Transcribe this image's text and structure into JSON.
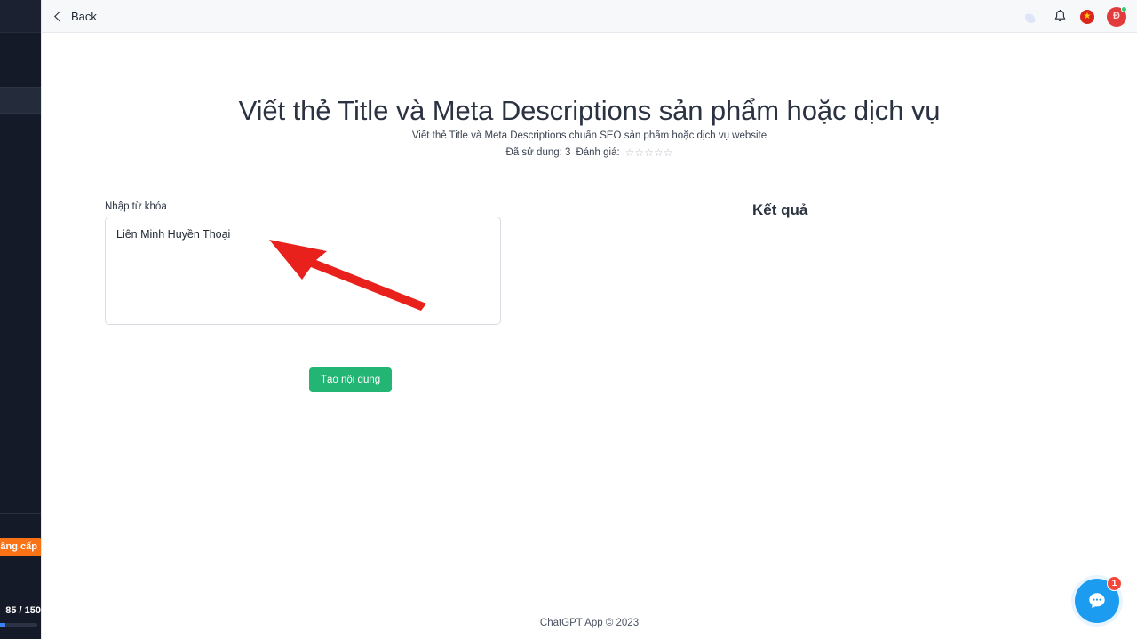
{
  "sidebar": {
    "upgrade_label": "Nâng cấp",
    "quota_label": "85 / 150",
    "quota_used": 85,
    "quota_total": 150,
    "progress_percent": 57,
    "accent_color": "#f97316",
    "progress_color": "#3b82f6",
    "background_color": "#151a28"
  },
  "topbar": {
    "back_label": "Back",
    "dark_mode_icon": "moon-icon",
    "notifications_icon": "bell-icon",
    "language_icon": "vietnam-flag-icon",
    "avatar_initial": "Đ",
    "avatar_color": "#e23b3b",
    "status_color": "#2ecc71",
    "background_color": "#f7f8fa"
  },
  "main": {
    "title": "Viết thẻ Title và Meta Descriptions sản phẩm hoặc dịch vụ",
    "subtitle": "Viết thẻ Title và Meta Descriptions chuẩn SEO sản phẩm hoặc dịch vụ website",
    "usage_label": "Đã sử dụng: 3",
    "rating_label": "Đánh giá:",
    "rating_stars": "☆☆☆☆☆",
    "rating_value": 0,
    "rating_max": 5
  },
  "form": {
    "keyword_label": "Nhập từ khóa",
    "keyword_value": "Liên Minh Huyền Thoại",
    "keyword_placeholder": "",
    "submit_label": "Tạo nội dung",
    "submit_color": "#22b573"
  },
  "result": {
    "title": "Kết quả",
    "body": ""
  },
  "footer": {
    "text": "ChatGPT App © 2023"
  },
  "chat_widget": {
    "badge_count": "1",
    "icon": "chat-bubble-icon",
    "color": "#1b9cf0",
    "badge_color": "#f3473b"
  },
  "annotation": {
    "type": "arrow",
    "color": "#e8211d",
    "points_to": "keyword-textarea"
  }
}
